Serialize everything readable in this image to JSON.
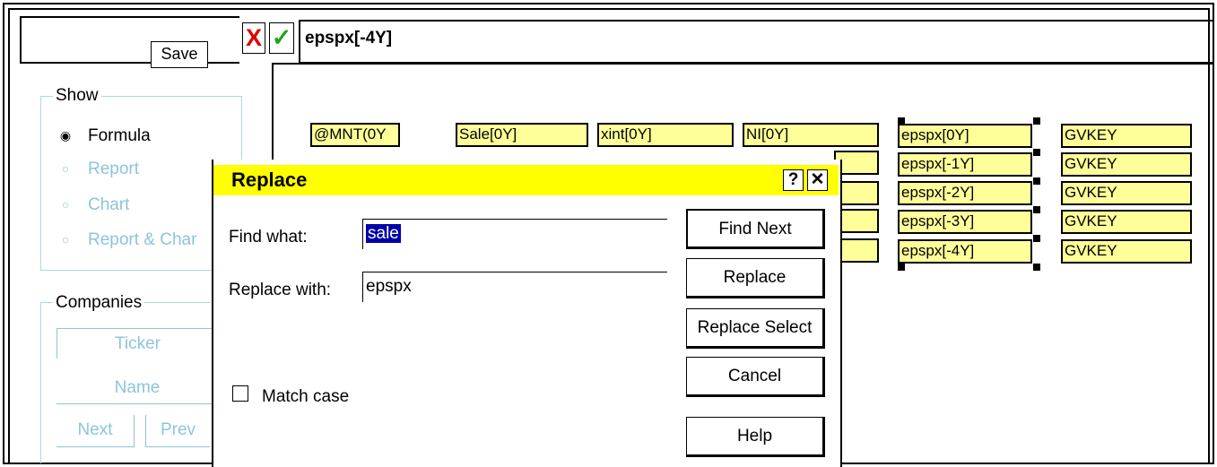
{
  "toolbar": {
    "save_label": "Save",
    "cancel_glyph": "X",
    "accept_glyph": "✓",
    "formula_text": "epspx[-4Y]"
  },
  "show_group": {
    "title": "Show",
    "options": [
      "Formula",
      "Report",
      "Chart",
      "Report & Char"
    ],
    "selected": "Formula"
  },
  "companies_group": {
    "title": "Companies",
    "ticker_label": "Ticker",
    "name_label": "Name",
    "next_label": "Next",
    "prev_label": "Prev"
  },
  "grid": {
    "row0": [
      "@MNT(0Y",
      "Sale[0Y]",
      "xint[0Y]",
      "NI[0Y]",
      "epspx[0Y]",
      "GVKEY"
    ],
    "epspx_column": [
      "epspx[0Y]",
      "epspx[-1Y]",
      "epspx[-2Y]",
      "epspx[-3Y]",
      "epspx[-4Y]"
    ],
    "gvkey_column": [
      "GVKEY",
      "GVKEY",
      "GVKEY",
      "GVKEY",
      "GVKEY"
    ]
  },
  "dialog": {
    "title": "Replace",
    "help_glyph": "?",
    "close_glyph": "✕",
    "find_label": "Find what:",
    "find_value": "sale",
    "replace_label": "Replace with:",
    "replace_value": "epspx",
    "match_case_label": "Match case",
    "buttons": {
      "find_next": "Find Next",
      "replace": "Replace",
      "replace_select": "Replace Select",
      "cancel": "Cancel",
      "help": "Help"
    }
  },
  "colors": {
    "field_fill": "#ffff99",
    "title_bar": "#ffff00",
    "selection": "#0000a8",
    "disabled_text": "#8ec4da"
  }
}
